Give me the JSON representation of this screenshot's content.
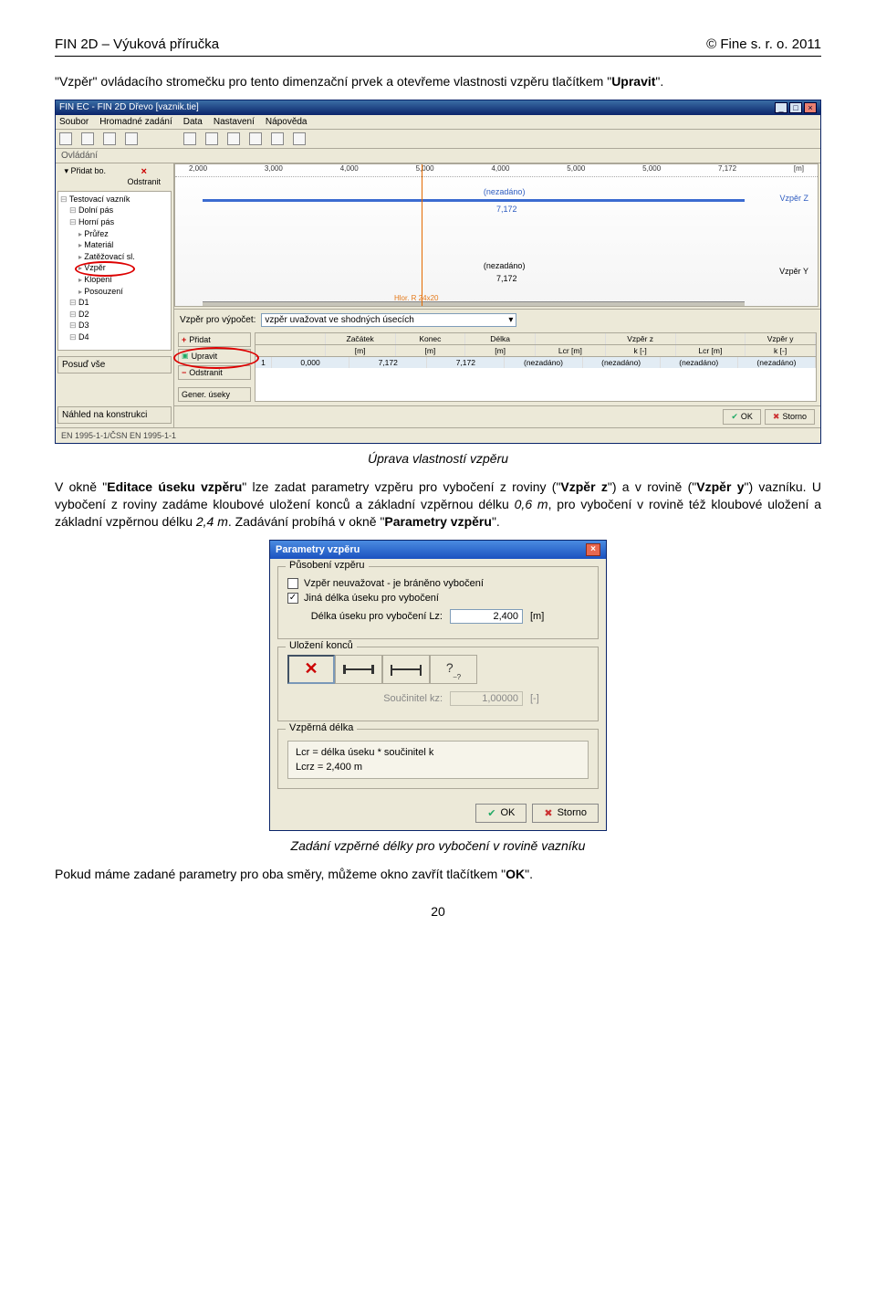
{
  "header": {
    "left": "FIN 2D – Výuková příručka",
    "right": "© Fine s. r. o. 2011"
  },
  "intro": {
    "p1_a": "\"Vzpěr\" ovládacího stromečku pro tento dimenzační prvek a otevřeme vlastnosti vzpěru tlačítkem \"",
    "p1_b": "Upravit",
    "p1_c": "\"."
  },
  "app": {
    "title": "FIN EC - FIN 2D Dřevo [vaznik.tie]",
    "menu": [
      "Soubor",
      "Hromadné zadání",
      "Data",
      "Nastavení",
      "Nápověda"
    ],
    "ovladani": "Ovládání",
    "left_btns": {
      "add": "Přidat bo.",
      "remove": "Odstranit"
    },
    "tree": {
      "root": "Testovací vazník",
      "items": [
        "Dolní pás",
        "Horní pás",
        "Průřez",
        "Materiál",
        "Zatěžovací sl.",
        "Vzpěr",
        "Klopení",
        "Posouzení",
        "D1",
        "D2",
        "D3",
        "D4"
      ]
    },
    "posud_vse": "Posuď vše",
    "nahled": "Náhled na konstrukci",
    "ruler": [
      "2,000",
      "3,000",
      "4,000",
      "5,000",
      "4,000",
      "5,000",
      "5,000",
      "7,172"
    ],
    "ruler_unit": "[m]",
    "nezadano": "(nezadáno)",
    "dim": "7,172",
    "vz": "Vzpěr Z",
    "vy": "Vzpěr Y",
    "hint": "Hlor. R 24x20",
    "combo_label": "Vzpěr pro výpočet:",
    "combo_value": "vzpěr uvažovat ve shodných úsecích",
    "actions": {
      "add": "Přidat",
      "edit": "Upravit",
      "del": "Odstranit",
      "gen": "Gener. úseky"
    },
    "table": {
      "head1": [
        "",
        "Začátek",
        "Konec",
        "Délka",
        "",
        "Vzpěr z",
        "",
        "Vzpěr y"
      ],
      "head2": [
        "",
        "[m]",
        "[m]",
        "[m]",
        "Lcr [m]",
        "k [-]",
        "Lcr [m]",
        "k [-]"
      ],
      "row": [
        "1",
        "0,000",
        "7,172",
        "7,172",
        "(nezadáno)",
        "(nezadáno)",
        "(nezadáno)",
        "(nezadáno)"
      ]
    },
    "ok": "OK",
    "storno": "Storno",
    "en": "EN 1995-1-1/ČSN EN 1995-1-1"
  },
  "caption1": "Úprava vlastností vzpěru",
  "mid": {
    "t1": "V okně \"",
    "t2": "Editace úseku vzpěru",
    "t3": "\" lze zadat parametry vzpěru pro vybočení z roviny (\"",
    "t4": "Vzpěr z",
    "t5": "\") a v rovině (\"",
    "t6": "Vzpěr y",
    "t7": "\") vazníku. U vybočení z roviny zadáme kloubové uložení konců a základní vzpěrnou délku ",
    "t8": "0,6 m",
    "t9": ", pro vybočení v rovině též kloubové uložení a základní vzpěrnou délku ",
    "t10": "2,4 m",
    "t11": ". Zadávání probíhá v okně \"",
    "t12": "Parametry vzpěru",
    "t13": "\"."
  },
  "dlg": {
    "title": "Parametry vzpěru",
    "g1": "Působení vzpěru",
    "c1": "Vzpěr neuvažovat - je bráněno vybočení",
    "c2": "Jiná délka úseku pro vybočení",
    "f1_label": "Délka úseku pro vybočení Lz:",
    "f1_value": "2,400",
    "f1_unit": "[m]",
    "g2": "Uložení konců",
    "kz_label": "Součinitel kz:",
    "kz_value": "1,00000",
    "kz_unit": "[-]",
    "g3": "Vzpěrná délka",
    "eq1": "Lcr = délka úseku * součinitel k",
    "eq2": "Lcrz = 2,400 m",
    "ok": "OK",
    "storno": "Storno"
  },
  "caption2": "Zadání vzpěrné délky pro vybočení v rovině vazníku",
  "outro": {
    "t1": "Pokud máme zadané parametry pro oba směry, můžeme okno zavřít tlačítkem \"",
    "t2": "OK",
    "t3": "\"."
  },
  "pagenum": "20"
}
